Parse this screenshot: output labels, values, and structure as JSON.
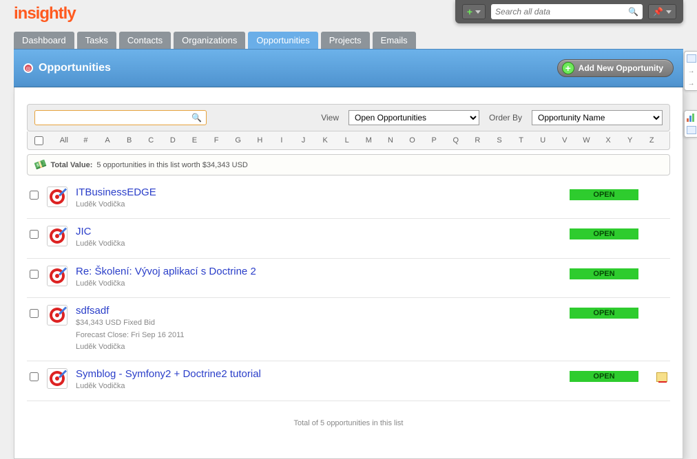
{
  "logo": "insightly",
  "topbar": {
    "search_placeholder": "Search all data"
  },
  "tabs": [
    {
      "label": "Dashboard",
      "active": false
    },
    {
      "label": "Tasks",
      "active": false
    },
    {
      "label": "Contacts",
      "active": false
    },
    {
      "label": "Organizations",
      "active": false
    },
    {
      "label": "Opportunities",
      "active": true
    },
    {
      "label": "Projects",
      "active": false
    },
    {
      "label": "Emails",
      "active": false
    }
  ],
  "page": {
    "title": "Opportunities",
    "add_label": "Add New Opportunity"
  },
  "filter": {
    "view_label": "View",
    "view_value": "Open Opportunities",
    "order_label": "Order By",
    "order_value": "Opportunity Name"
  },
  "alpha": [
    "All",
    "#",
    "A",
    "B",
    "C",
    "D",
    "E",
    "F",
    "G",
    "H",
    "I",
    "J",
    "K",
    "L",
    "M",
    "N",
    "O",
    "P",
    "Q",
    "R",
    "S",
    "T",
    "U",
    "V",
    "W",
    "X",
    "Y",
    "Z"
  ],
  "total": {
    "label": "Total Value:",
    "text": "5 opportunities in this list worth $34,343 USD"
  },
  "rows": [
    {
      "title": "ITBusinessEDGE",
      "lines": [
        "Luděk Vodička"
      ],
      "status": "OPEN",
      "note": false
    },
    {
      "title": "JIC",
      "lines": [
        "Luděk Vodička"
      ],
      "status": "OPEN",
      "note": false
    },
    {
      "title": "Re: Školení: Vývoj aplikací s Doctrine 2",
      "lines": [
        "Luděk Vodička"
      ],
      "status": "OPEN",
      "note": false
    },
    {
      "title": "sdfsadf",
      "lines": [
        "$34,343 USD Fixed Bid",
        "Forecast Close: Fri Sep 16 2011",
        "Luděk Vodička"
      ],
      "status": "OPEN",
      "note": false
    },
    {
      "title": "Symblog - Symfony2 + Doctrine2 tutorial",
      "lines": [
        "Luděk Vodička"
      ],
      "status": "OPEN",
      "note": true
    }
  ],
  "footer": "Total of 5 opportunities in this list"
}
